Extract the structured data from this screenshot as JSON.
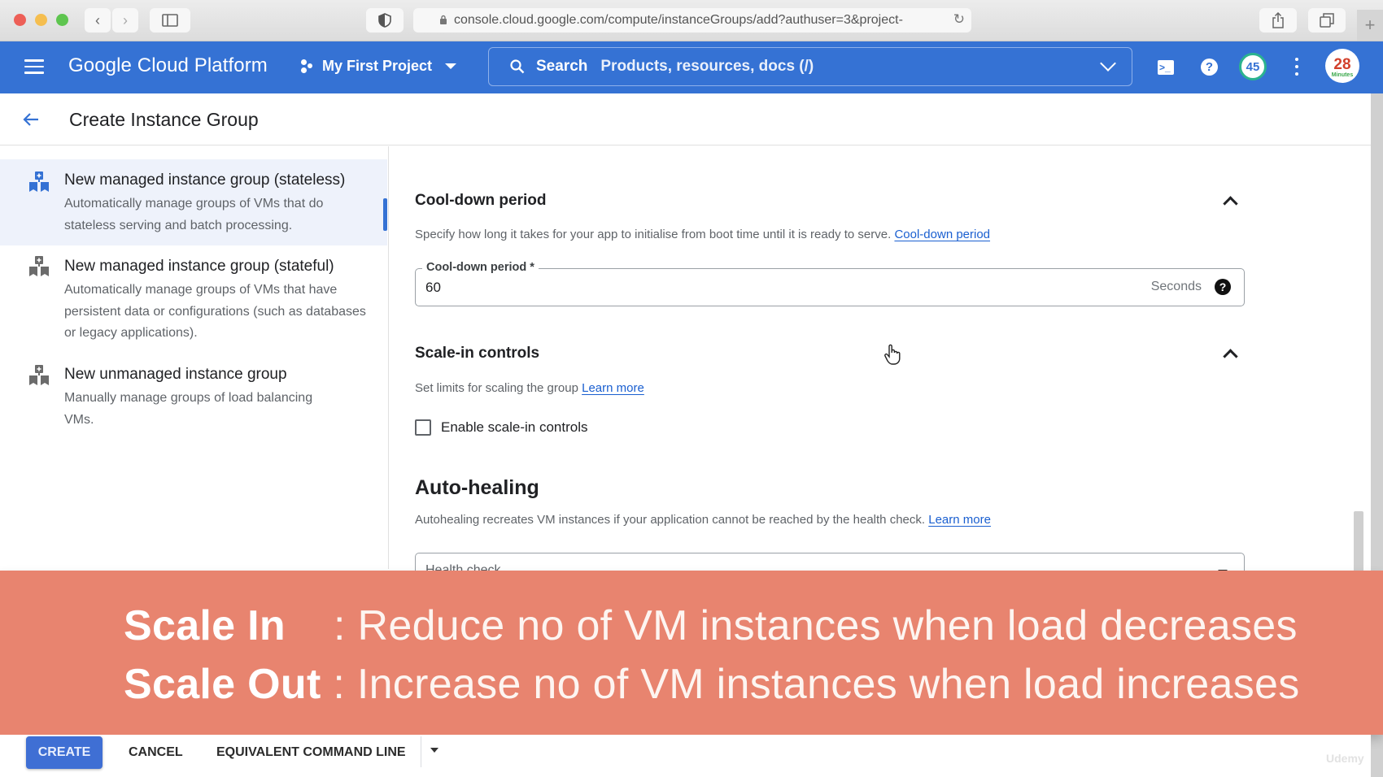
{
  "browser": {
    "url": "console.cloud.google.com/compute/instanceGroups/add?authuser=3&project-"
  },
  "header": {
    "brand": "Google Cloud Platform",
    "project": "My First Project",
    "search_label": "Search",
    "search_placeholder": "Products, resources, docs (/)",
    "notification_count": "45",
    "avatar_text": "28",
    "avatar_sub": "Minutes"
  },
  "page": {
    "title": "Create Instance Group"
  },
  "sidebar": {
    "options": [
      {
        "title": "New managed instance group (stateless)",
        "description": "Automatically manage groups of VMs that do stateless serving and batch processing.",
        "selected": true
      },
      {
        "title": "New managed instance group (stateful)",
        "description": "Automatically manage groups of VMs that have persistent data or configurations (such as databases or legacy applications).",
        "selected": false
      },
      {
        "title": "New unmanaged instance group",
        "description": "Manually manage groups of load balancing VMs.",
        "selected": false
      }
    ]
  },
  "main": {
    "cooldown": {
      "title": "Cool-down period",
      "description": "Specify how long it takes for your app to initialise from boot time until it is ready to serve.",
      "link": "Cool-down period",
      "field_label": "Cool-down period *",
      "field_value": "60",
      "field_suffix": "Seconds"
    },
    "scale_in": {
      "title": "Scale-in controls",
      "description": "Set limits for scaling the group",
      "link": "Learn more",
      "checkbox_label": "Enable scale-in controls",
      "checked": false
    },
    "autohealing": {
      "title": "Auto-healing",
      "description": "Autohealing recreates VM instances if your application cannot be reached by the health check.",
      "link": "Learn more",
      "health_check_label": "Health check"
    }
  },
  "banner": {
    "line1_term": "Scale In",
    "line1_text": ": Reduce no of VM instances when load decreases",
    "line2_term": "Scale Out",
    "line2_text": ": Increase no of VM instances when load increases",
    "color": "#e8846f"
  },
  "footer": {
    "create": "CREATE",
    "cancel": "CANCEL",
    "command_line": "EQUIVALENT COMMAND LINE"
  },
  "watermark": "Udemy"
}
